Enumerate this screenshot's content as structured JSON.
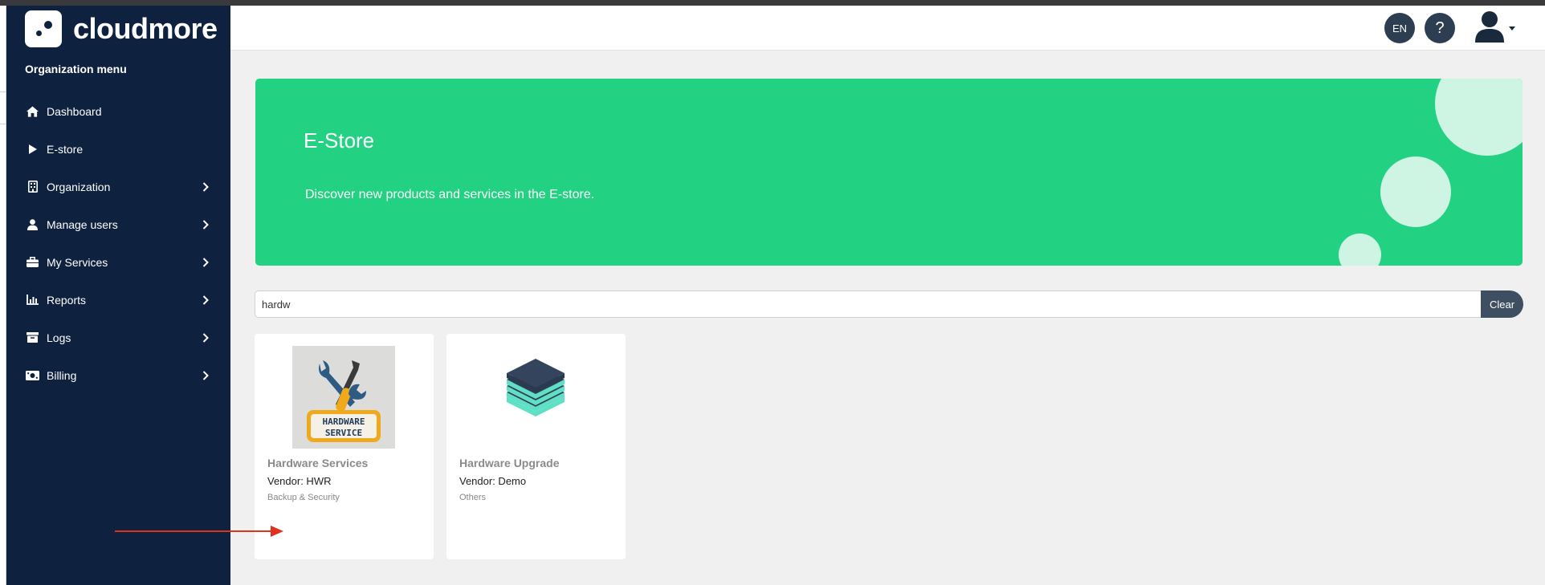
{
  "brand": {
    "name": "cloudmore",
    "logo_icon": "cloudmore-logo-icon"
  },
  "sidebar": {
    "title": "Organization menu",
    "items": [
      {
        "label": "Dashboard",
        "icon": "home-icon",
        "has_submenu": false
      },
      {
        "label": "E-store",
        "icon": "play-icon",
        "has_submenu": false
      },
      {
        "label": "Organization",
        "icon": "building-icon",
        "has_submenu": true
      },
      {
        "label": "Manage users",
        "icon": "user-icon",
        "has_submenu": true
      },
      {
        "label": "My Services",
        "icon": "briefcase-icon",
        "has_submenu": true
      },
      {
        "label": "Reports",
        "icon": "chart-icon",
        "has_submenu": true
      },
      {
        "label": "Logs",
        "icon": "archive-icon",
        "has_submenu": true
      },
      {
        "label": "Billing",
        "icon": "money-icon",
        "has_submenu": true
      }
    ]
  },
  "topbar": {
    "language": "EN",
    "help": "?",
    "user_icon": "user-avatar-icon"
  },
  "banner": {
    "title": "E-Store",
    "subtitle": "Discover new products and services in the E-store.",
    "color": "#22d182"
  },
  "search": {
    "value": "hardw",
    "clear_label": "Clear"
  },
  "products": [
    {
      "title": "Hardware Services",
      "vendor": "Vendor: HWR",
      "category": "Backup & Security",
      "image_icon": "hardware-service-tools-icon",
      "image_text_line1": "HARDWARE",
      "image_text_line2": "SERVICE"
    },
    {
      "title": "Hardware Upgrade",
      "vendor": "Vendor: Demo",
      "category": "Others",
      "image_icon": "layers-stack-icon"
    }
  ],
  "colors": {
    "sidebar_bg": "#0e2240",
    "accent_green": "#22d182",
    "button_dark": "#3e4f62",
    "annotation_arrow": "#e0301e"
  }
}
